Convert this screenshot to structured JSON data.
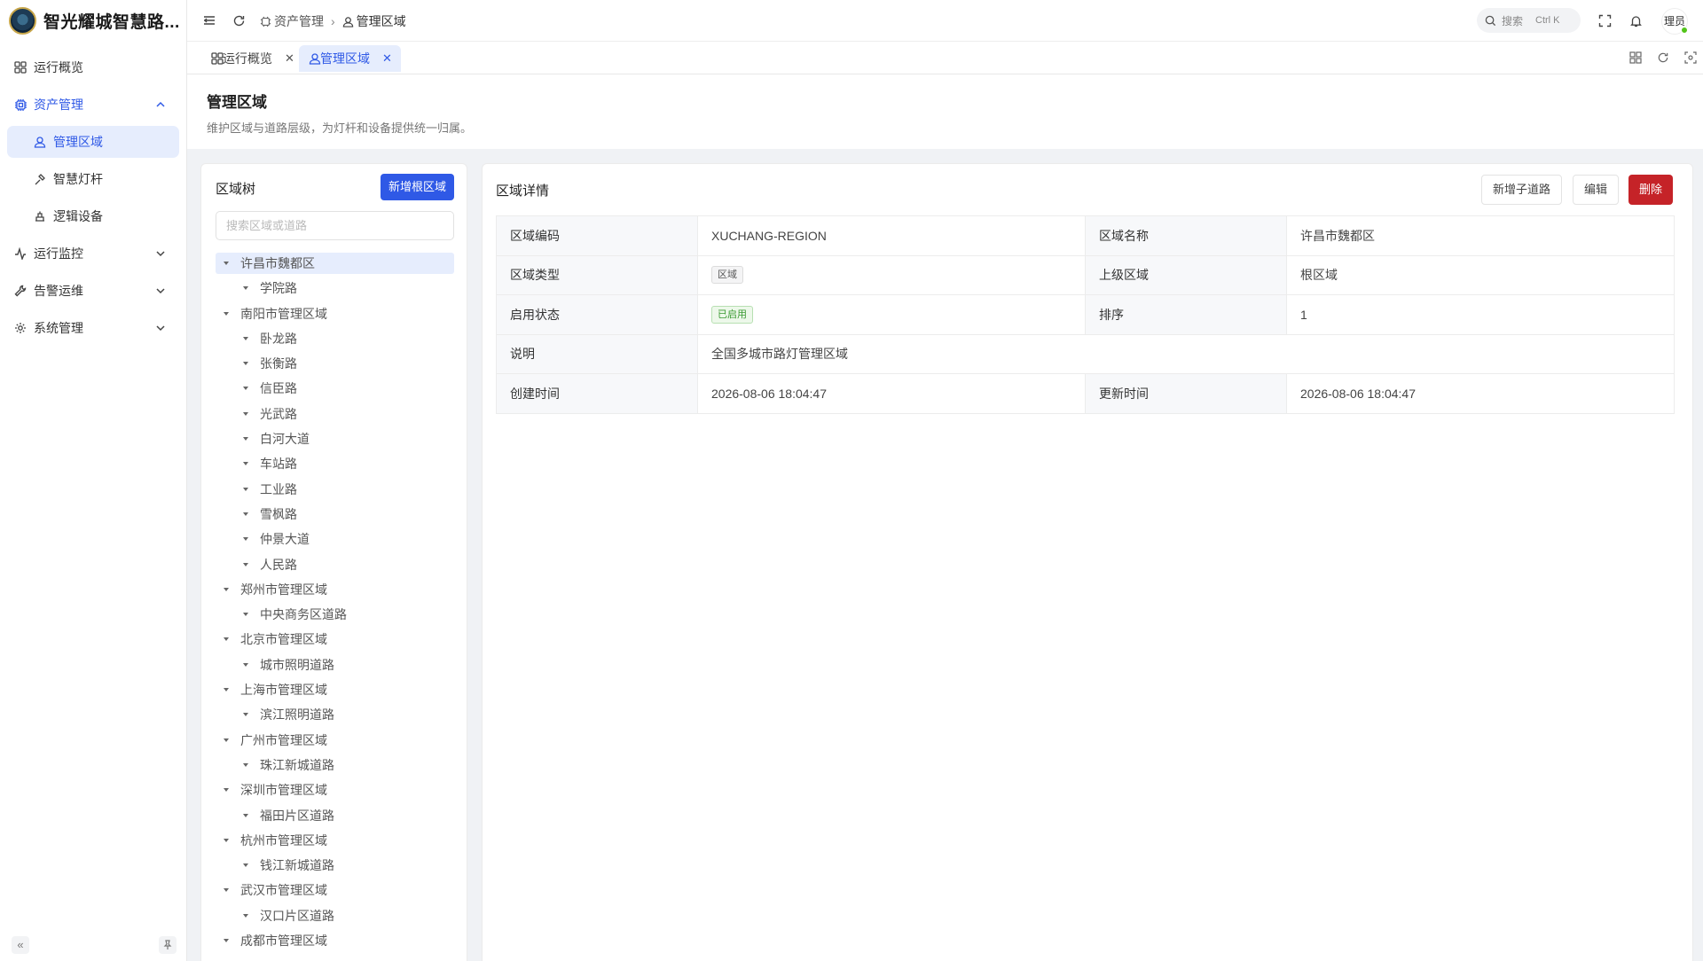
{
  "app": {
    "title": "智光耀城智慧路..."
  },
  "sidebar": {
    "menu": [
      {
        "label": "运行概览",
        "icon": "dashboard-icon"
      },
      {
        "label": "资产管理",
        "icon": "chip-icon",
        "expanded": true
      },
      {
        "label": "管理区域",
        "icon": "user-region-icon",
        "active": true
      },
      {
        "label": "智慧灯杆",
        "icon": "lamp-icon"
      },
      {
        "label": "逻辑设备",
        "icon": "device-icon"
      },
      {
        "label": "运行监控",
        "icon": "pulse-icon"
      },
      {
        "label": "告警运维",
        "icon": "wrench-icon"
      },
      {
        "label": "系统管理",
        "icon": "gear-icon"
      }
    ]
  },
  "header": {
    "breadcrumb": [
      "资产管理",
      "管理区域"
    ],
    "search_label": "搜索",
    "search_shortcut": "Ctrl K",
    "user": "理员"
  },
  "tabs": [
    {
      "label": "运行概览",
      "closable": true,
      "active": false
    },
    {
      "label": "管理区域",
      "closable": true,
      "active": true
    }
  ],
  "page": {
    "title": "管理区域",
    "description": "维护区域与道路层级，为灯杆和设备提供统一归属。"
  },
  "tree_panel": {
    "title": "区域树",
    "add_root_button": "新增根区域",
    "search_placeholder": "搜索区域或道路",
    "nodes": [
      {
        "label": "许昌市魏都区",
        "level": 0,
        "selected": true
      },
      {
        "label": "学院路",
        "level": 1
      },
      {
        "label": "南阳市管理区域",
        "level": 0
      },
      {
        "label": "卧龙路",
        "level": 1
      },
      {
        "label": "张衡路",
        "level": 1
      },
      {
        "label": "信臣路",
        "level": 1
      },
      {
        "label": "光武路",
        "level": 1
      },
      {
        "label": "白河大道",
        "level": 1
      },
      {
        "label": "车站路",
        "level": 1
      },
      {
        "label": "工业路",
        "level": 1
      },
      {
        "label": "雪枫路",
        "level": 1
      },
      {
        "label": "仲景大道",
        "level": 1
      },
      {
        "label": "人民路",
        "level": 1
      },
      {
        "label": "郑州市管理区域",
        "level": 0
      },
      {
        "label": "中央商务区道路",
        "level": 1
      },
      {
        "label": "北京市管理区域",
        "level": 0
      },
      {
        "label": "城市照明道路",
        "level": 1
      },
      {
        "label": "上海市管理区域",
        "level": 0
      },
      {
        "label": "滨江照明道路",
        "level": 1
      },
      {
        "label": "广州市管理区域",
        "level": 0
      },
      {
        "label": "珠江新城道路",
        "level": 1
      },
      {
        "label": "深圳市管理区域",
        "level": 0
      },
      {
        "label": "福田片区道路",
        "level": 1
      },
      {
        "label": "杭州市管理区域",
        "level": 0
      },
      {
        "label": "钱江新城道路",
        "level": 1
      },
      {
        "label": "武汉市管理区域",
        "level": 0
      },
      {
        "label": "汉口片区道路",
        "level": 1
      },
      {
        "label": "成都市管理区域",
        "level": 0
      }
    ]
  },
  "detail_panel": {
    "title": "区域详情",
    "buttons": {
      "add_child": "新增子道路",
      "edit": "编辑",
      "delete": "删除"
    },
    "fields": {
      "code_label": "区域编码",
      "code": "XUCHANG-REGION",
      "name_label": "区域名称",
      "name": "许昌市魏都区",
      "type_label": "区域类型",
      "type": "区域",
      "parent_label": "上级区域",
      "parent": "根区域",
      "status_label": "启用状态",
      "status": "已启用",
      "sort_label": "排序",
      "sort": "1",
      "desc_label": "说明",
      "desc": "全国多城市路灯管理区域",
      "created_label": "创建时间",
      "created": "2026-08-06 18:04:47",
      "updated_label": "更新时间",
      "updated": "2026-08-06 18:04:47"
    }
  },
  "colors": {
    "primary": "#2f59e6",
    "active_bg": "#e6edfd",
    "danger": "#c52328",
    "success": "#3a9a32"
  }
}
